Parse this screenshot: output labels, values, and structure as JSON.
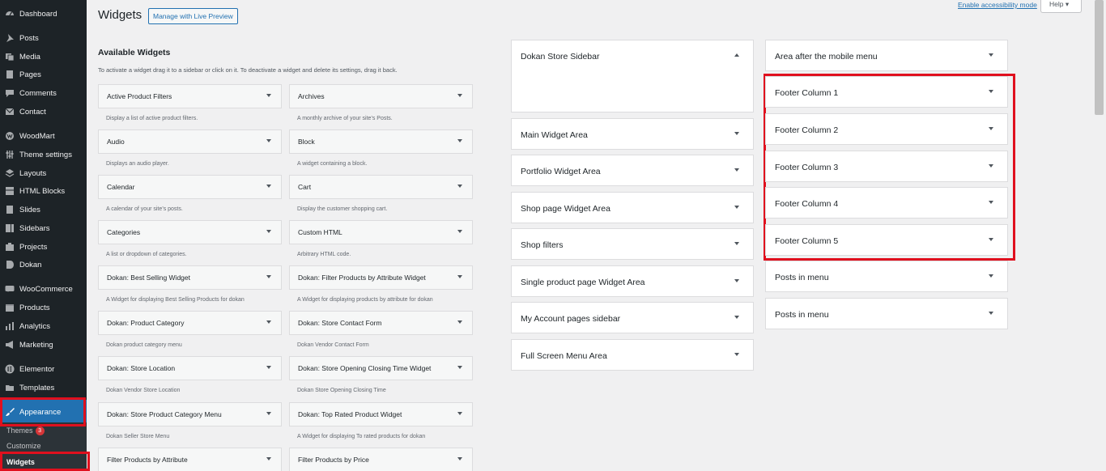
{
  "menu": [
    {
      "label": "Dashboard",
      "icon": "dashboard-icon"
    },
    {
      "label": "Posts",
      "icon": "pin-icon"
    },
    {
      "label": "Media",
      "icon": "media-icon"
    },
    {
      "label": "Pages",
      "icon": "page-icon"
    },
    {
      "label": "Comments",
      "icon": "comment-icon"
    },
    {
      "label": "Contact",
      "icon": "mail-icon"
    },
    {
      "label": "WoodMart",
      "icon": "woodmart-icon"
    },
    {
      "label": "Theme settings",
      "icon": "sliders-icon"
    },
    {
      "label": "Layouts",
      "icon": "layers-icon"
    },
    {
      "label": "HTML Blocks",
      "icon": "blocks-icon"
    },
    {
      "label": "Slides",
      "icon": "slides-icon"
    },
    {
      "label": "Sidebars",
      "icon": "sidebars-icon"
    },
    {
      "label": "Projects",
      "icon": "projects-icon"
    },
    {
      "label": "Dokan",
      "icon": "dokan-icon"
    },
    {
      "label": "WooCommerce",
      "icon": "woo-icon"
    },
    {
      "label": "Products",
      "icon": "box-icon"
    },
    {
      "label": "Analytics",
      "icon": "chart-icon"
    },
    {
      "label": "Marketing",
      "icon": "megaphone-icon"
    },
    {
      "label": "Elementor",
      "icon": "elementor-icon"
    },
    {
      "label": "Templates",
      "icon": "folder-icon"
    },
    {
      "label": "Appearance",
      "icon": "brush-icon"
    }
  ],
  "submenu": {
    "themes": "Themes",
    "themes_badge": "3",
    "customize": "Customize",
    "widgets": "Widgets"
  },
  "header": {
    "title": "Widgets",
    "live_preview": "Manage with Live Preview",
    "accessibility": "Enable accessibility mode",
    "help": "Help ▾"
  },
  "available": {
    "title": "Available Widgets",
    "description": "To activate a widget drag it to a sidebar or click on it. To deactivate a widget and delete its settings, drag it back.",
    "widgets": [
      {
        "title": "Active Product Filters",
        "desc": "Display a list of active product filters."
      },
      {
        "title": "Archives",
        "desc": "A monthly archive of your site’s Posts."
      },
      {
        "title": "Audio",
        "desc": "Displays an audio player."
      },
      {
        "title": "Block",
        "desc": "A widget containing a block."
      },
      {
        "title": "Calendar",
        "desc": "A calendar of your site’s posts."
      },
      {
        "title": "Cart",
        "desc": "Display the customer shopping cart."
      },
      {
        "title": "Categories",
        "desc": "A list or dropdown of categories."
      },
      {
        "title": "Custom HTML",
        "desc": "Arbitrary HTML code."
      },
      {
        "title": "Dokan: Best Selling Widget",
        "desc": "A Widget for displaying Best Selling Products for dokan"
      },
      {
        "title": "Dokan: Filter Products by Attribute Widget",
        "desc": "A Widget for displaying products by attribute for dokan"
      },
      {
        "title": "Dokan: Product Category",
        "desc": "Dokan product category menu"
      },
      {
        "title": "Dokan: Store Contact Form",
        "desc": "Dokan Vendor Contact Form"
      },
      {
        "title": "Dokan: Store Location",
        "desc": "Dokan Vendor Store Location"
      },
      {
        "title": "Dokan: Store Opening Closing Time Widget",
        "desc": "Dokan Store Opening Closing Time"
      },
      {
        "title": "Dokan: Store Product Category Menu",
        "desc": "Dokan Seller Store Menu"
      },
      {
        "title": "Dokan: Top Rated Product Widget",
        "desc": "A Widget for displaying To rated products for dokan"
      },
      {
        "title": "Filter Products by Attribute",
        "desc": ""
      },
      {
        "title": "Filter Products by Price",
        "desc": ""
      }
    ]
  },
  "areas_left": [
    {
      "title": "Dokan Store Sidebar",
      "open": true
    },
    {
      "title": "Main Widget Area"
    },
    {
      "title": "Portfolio Widget Area"
    },
    {
      "title": "Shop page Widget Area"
    },
    {
      "title": "Shop filters"
    },
    {
      "title": "Single product page Widget Area"
    },
    {
      "title": "My Account pages sidebar"
    },
    {
      "title": "Full Screen Menu Area"
    }
  ],
  "areas_right": [
    {
      "title": "Area after the mobile menu"
    },
    {
      "title": "Footer Column 1"
    },
    {
      "title": "Footer Column 2"
    },
    {
      "title": "Footer Column 3"
    },
    {
      "title": "Footer Column 4"
    },
    {
      "title": "Footer Column 5"
    },
    {
      "title": "Posts in menu"
    },
    {
      "title": "Posts in menu"
    }
  ],
  "colors": {
    "menu_bg": "#1d2327",
    "menu_current": "#2271b1",
    "highlight": "#e0101e"
  }
}
